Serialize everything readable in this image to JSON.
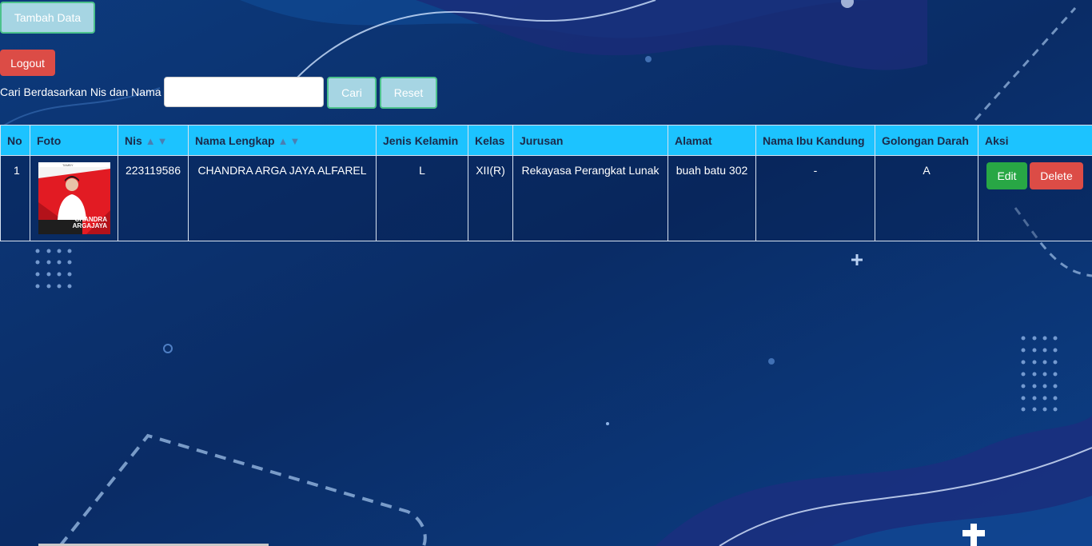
{
  "toolbar": {
    "add_label": "Tambah Data",
    "logout_label": "Logout"
  },
  "search": {
    "label": "Cari Berdasarkan Nis dan Nama",
    "value": "",
    "placeholder": "",
    "search_label": "Cari",
    "reset_label": "Reset"
  },
  "table": {
    "headers": {
      "no": "No",
      "foto": "Foto",
      "nis": "Nis",
      "nama": "Nama Lengkap",
      "jenis_kelamin": "Jenis Kelamin",
      "kelas": "Kelas",
      "jurusan": "Jurusan",
      "alamat": "Alamat",
      "ibu": "Nama Ibu Kandung",
      "goldar": "Golongan Darah",
      "aksi": "Aksi"
    },
    "sort_glyph": "▲▼",
    "rows": [
      {
        "no": "1",
        "photo_text_top": "CHANDRA",
        "photo_text_bottom": "ARGAJAYA",
        "nis": "223119586",
        "nama": "CHANDRA ARGA JAYA ALFAREL",
        "jenis_kelamin": "L",
        "kelas": "XII(R)",
        "jurusan": "Rekayasa Perangkat Lunak",
        "alamat": "buah batu 302",
        "ibu": "-",
        "goldar": "A",
        "edit_label": "Edit",
        "delete_label": "Delete"
      }
    ]
  },
  "colors": {
    "background": "#0b2c63",
    "header": "#1cc3ff",
    "add_button": "#a6d5e3",
    "logout_button": "#dc4c46",
    "edit_button": "#28a745",
    "delete_button": "#dc4c46"
  }
}
